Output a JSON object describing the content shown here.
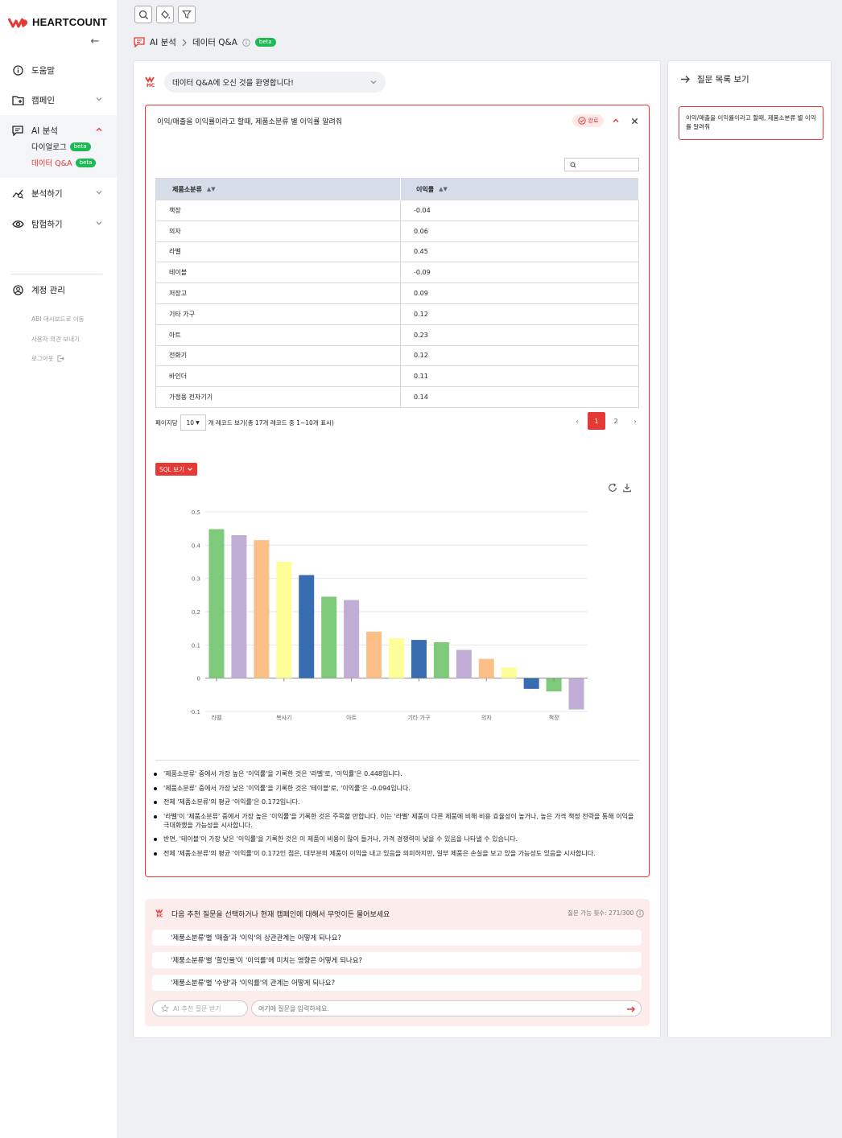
{
  "brand": {
    "name": "HEARTCOUNT",
    "color": "#e53935"
  },
  "sidebar": {
    "items": [
      {
        "label": "도움말",
        "icon": "info-icon"
      },
      {
        "label": "캠페인",
        "icon": "add-folder-icon"
      },
      {
        "label": "AI 분석",
        "icon": "chat-icon"
      },
      {
        "label": "분석하기",
        "icon": "analytics-icon"
      },
      {
        "label": "탐험하기",
        "icon": "eye-icon"
      }
    ],
    "ai_sub": [
      {
        "label": "다이얼로그",
        "badge": "beta"
      },
      {
        "label": "데이터 Q&A",
        "badge": "beta"
      }
    ],
    "account": "계정 관리",
    "links": [
      "ABI 대시보드로 이동",
      "사용자 의견 보내기",
      "로그아웃"
    ]
  },
  "breadcrumb": {
    "root": "AI 분석",
    "current": "데이터 Q&A",
    "badge": "beta"
  },
  "welcome": "데이터 Q&A에 오신 것을 환영합니다!",
  "qa": {
    "question": "이익/매출을 이익률이라고 할때, 제품소분류 별 이익률 알려줘",
    "status": "완료",
    "table": {
      "columns": [
        "제품소분류",
        "이익률"
      ],
      "rows": [
        [
          "책장",
          "-0.04"
        ],
        [
          "의자",
          "0.06"
        ],
        [
          "라벨",
          "0.45"
        ],
        [
          "테이블",
          "-0.09"
        ],
        [
          "저장고",
          "0.09"
        ],
        [
          "기타 가구",
          "0.12"
        ],
        [
          "아트",
          "0.23"
        ],
        [
          "전화기",
          "0.12"
        ],
        [
          "바인더",
          "0.11"
        ],
        [
          "가정용 전자기기",
          "0.14"
        ]
      ]
    },
    "pager": {
      "per_page_label": "페이지당",
      "per_page": "10",
      "info": "개 레코드 보기(총 17개 레코드 중 1~10개 표시)",
      "pages": [
        "‹",
        "1",
        "2",
        "›"
      ],
      "active": "1"
    },
    "sql_button": "SQL 보기",
    "summary": [
      "'제품소분류' 중에서 가장 높은 '이익률'을 기록한 것은 '라벨'로, '이익률'은 0.448입니다.",
      "'제품소분류' 중에서 가장 낮은 '이익률'을 기록한 것은 '테이블'로, '이익률'은 -0.094입니다.",
      "전체 '제품소분류'의 평균 '이익률'은 0.172입니다.",
      "'라벨'이 '제품소분류' 중에서 가장 높은 '이익률'을 기록한 것은 주목할 만합니다. 이는 '라벨' 제품이 다른 제품에 비해 비용 효율성이 높거나, 높은 가격 책정 전략을 통해 이익을 극대화했을 가능성을 시사합니다.",
      "반면, '테이블'이 가장 낮은 '이익률'을 기록한 것은 이 제품이 비용이 많이 들거나, 가격 경쟁력이 낮을 수 있음을 나타낼 수 있습니다.",
      "전체 '제품소분류'의 평균 '이익률'이 0.172인 점은, 대부분의 제품이 이익을 내고 있음을 의미하지만, 일부 제품은 손실을 보고 있을 가능성도 있음을 시사합니다."
    ]
  },
  "chart_data": {
    "type": "bar",
    "values": [
      0.448,
      0.43,
      0.415,
      0.35,
      0.31,
      0.245,
      0.235,
      0.14,
      0.12,
      0.115,
      0.108,
      0.085,
      0.058,
      0.032,
      -0.032,
      -0.04,
      -0.094
    ],
    "colors": [
      "#7ec97a",
      "#c0aed6",
      "#fbbf87",
      "#fefe99",
      "#386cb0",
      "#7ec97a",
      "#c0aed6",
      "#fbbf87",
      "#fefe99",
      "#386cb0",
      "#7ec97a",
      "#c0aed6",
      "#fbbf87",
      "#fefe99",
      "#386cb0",
      "#7ec97a",
      "#c0aed6"
    ],
    "tick_labels": [
      "라벨",
      "복사기",
      "아트",
      "기타 가구",
      "의자",
      "책장"
    ],
    "tick_indices": [
      0,
      3,
      6,
      9,
      12,
      15
    ],
    "yticks": [
      "0.5",
      "0.4",
      "0.3",
      "0.2",
      "0.1",
      "0",
      "-0.1"
    ],
    "ylim": [
      -0.1,
      0.5
    ]
  },
  "suggest": {
    "header": "다음 추천 질문을 선택하거나 현재 캠페인에 대해서 무엇이든 물어보세요",
    "quota": "질문 가능 횟수: 271/300",
    "items": [
      "'제품소분류'별 '매출'과 '이익'의 상관관계는 어떻게 되나요?",
      "'제품소분류'별 '할인율'이 '이익률'에 미치는 영향은 어떻게 되나요?",
      "'제품소분류'별 '수량'과 '이익률'의 관계는 어떻게 되나요?"
    ],
    "ai_button": "AI 추천 질문 받기",
    "placeholder": "여기에 질문을 입력하세요."
  },
  "right": {
    "header": "질문 목록 보기",
    "questions": [
      "이익/매출을 이익률이라고 할때, 제품소분류 별 이익률 알려줘"
    ]
  }
}
